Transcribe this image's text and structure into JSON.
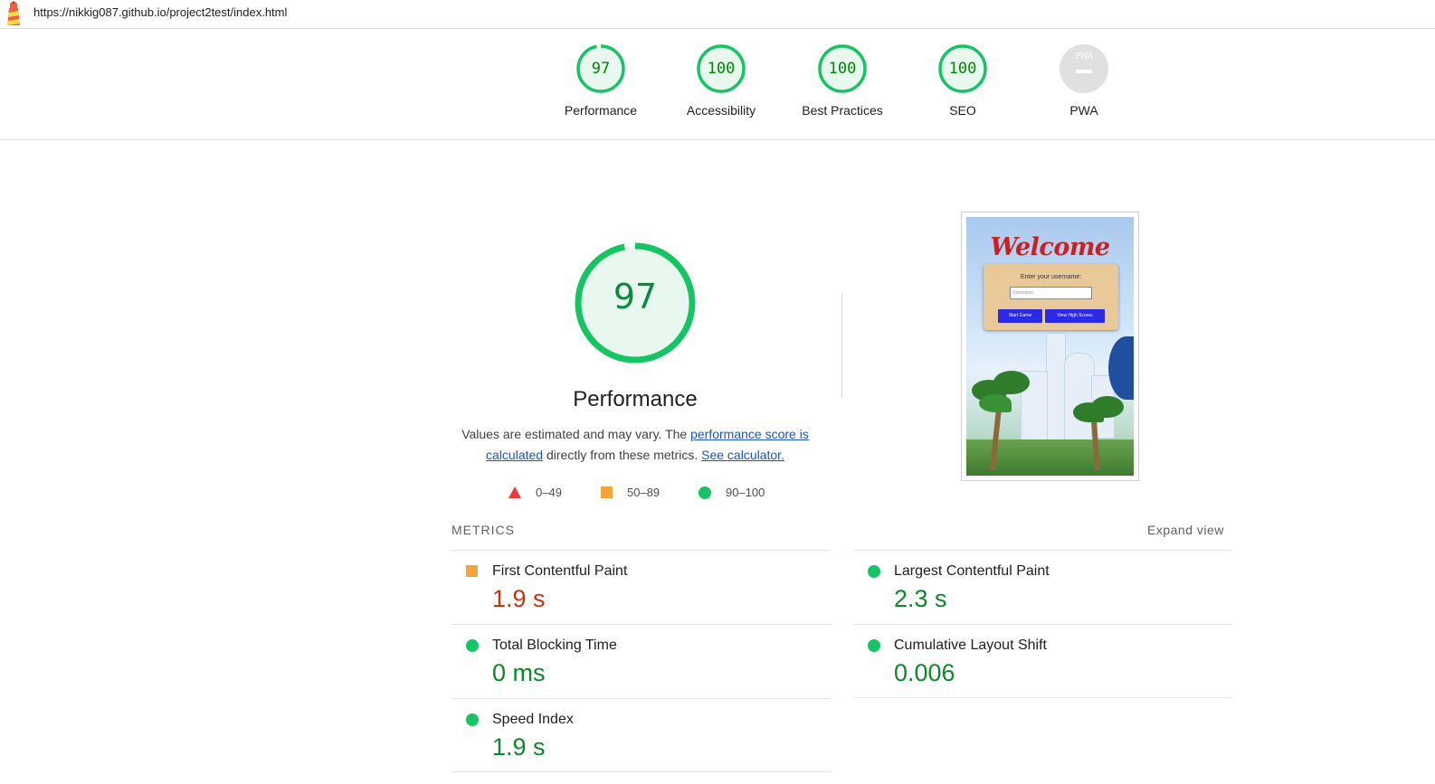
{
  "browser": {
    "url": "https://nikkig087.github.io/project2test/index.html",
    "icon": "lighthouse-icon"
  },
  "summary": {
    "gauges": [
      {
        "label": "Performance",
        "score": "97",
        "fraction": 0.97
      },
      {
        "label": "Accessibility",
        "score": "100",
        "fraction": 1.0
      },
      {
        "label": "Best Practices",
        "score": "100",
        "fraction": 1.0
      },
      {
        "label": "SEO",
        "score": "100",
        "fraction": 1.0
      }
    ],
    "pwa": {
      "label": "PWA",
      "badge_text": "PWA"
    }
  },
  "performance": {
    "score": "97",
    "fraction": 0.97,
    "title": "Performance",
    "desc_prefix": "Values are estimated and may vary. The ",
    "link1": "performance score is calculated",
    "desc_middle": " directly from these metrics. ",
    "link2": "See calculator."
  },
  "legend": [
    {
      "range": "0–49",
      "shape": "triangle",
      "color": "#eb3b3b"
    },
    {
      "range": "50–89",
      "shape": "square",
      "color": "#f4a53a"
    },
    {
      "range": "90–100",
      "shape": "circle",
      "color": "#16c463"
    }
  ],
  "screenshot": {
    "heading": "Welcome",
    "prompt": "Enter your username:",
    "input_placeholder": "Username",
    "start_button": "Start Game",
    "scores_button": "View High Scores"
  },
  "metrics": {
    "header": "METRICS",
    "expand": "Expand view",
    "items": [
      {
        "title": "First Contentful Paint",
        "value": "1.9 s",
        "status": "average"
      },
      {
        "title": "Largest Contentful Paint",
        "value": "2.3 s",
        "status": "pass"
      },
      {
        "title": "Total Blocking Time",
        "value": "0 ms",
        "status": "pass"
      },
      {
        "title": "Cumulative Layout Shift",
        "value": "0.006",
        "status": "pass"
      },
      {
        "title": "Speed Index",
        "value": "1.9 s",
        "status": "pass"
      }
    ]
  },
  "colors": {
    "pass": "#16c463",
    "pass_text": "#0a8a2a",
    "pass_fill": "#e8f8ee",
    "average": "#f4a53a",
    "average_text": "#c5360f",
    "link": "#1a56c6"
  }
}
